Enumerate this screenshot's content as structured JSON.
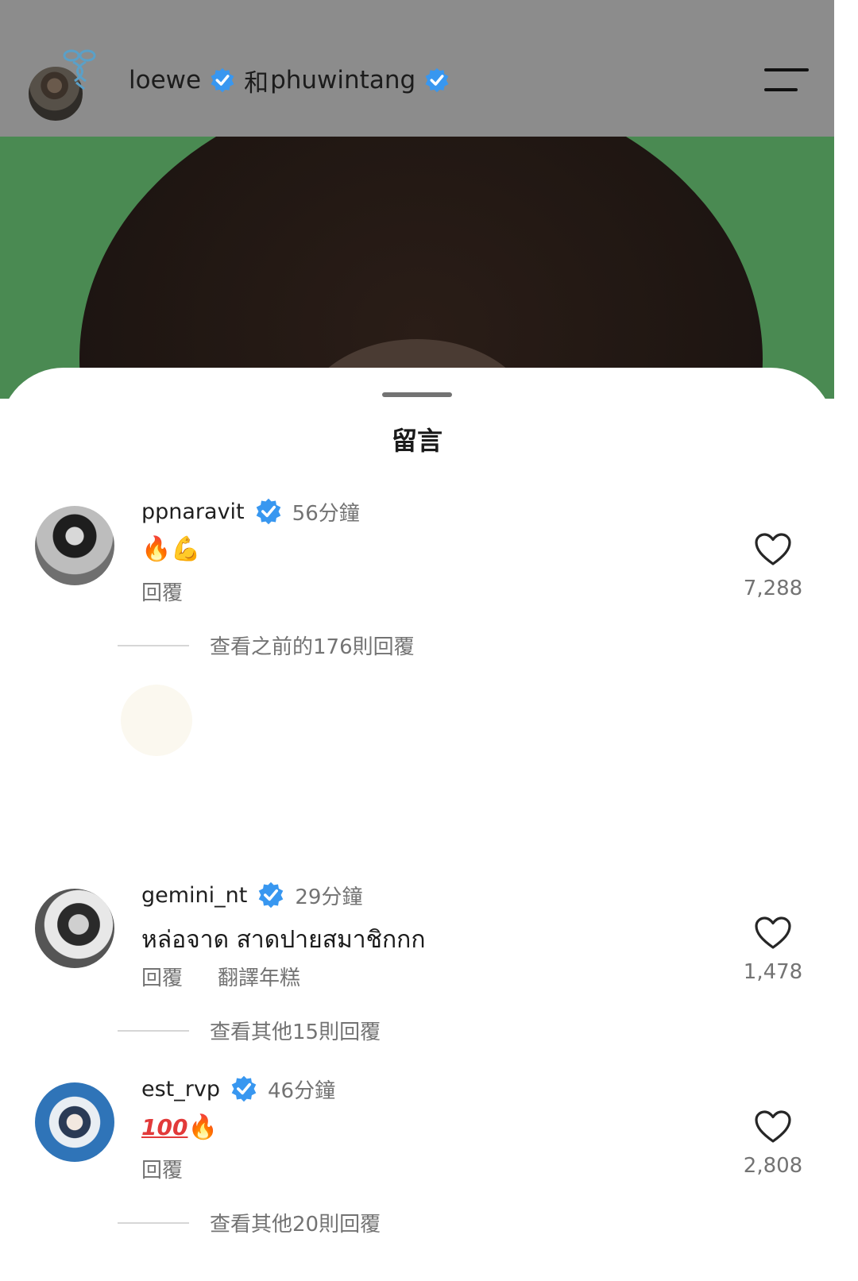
{
  "header": {
    "account1": "loewe",
    "joiner": "和",
    "account2": "phuwintang"
  },
  "sheet": {
    "title": "留言"
  },
  "comments": [
    {
      "username": "ppnaravit",
      "time": "56分鐘",
      "text": "🔥💪",
      "reply_label": "回覆",
      "likes": "7,288",
      "view_more": "查看之前的176則回覆"
    },
    {
      "username": "gemini_nt",
      "time": "29分鐘",
      "text": "หล่อจาด สาดปายสมาชิกกก",
      "reply_label": "回覆",
      "translate_label": "翻譯年糕",
      "likes": "1,478",
      "view_more": "查看其他15則回覆"
    },
    {
      "username": "est_rvp",
      "time": "46分鐘",
      "text_prefix": "100",
      "text_suffix": "🔥",
      "reply_label": "回覆",
      "likes": "2,808",
      "view_more": "查看其他20則回覆"
    }
  ],
  "colors": {
    "verified": "#3897f0",
    "header_bg": "#8c8c8c",
    "photo_green": "#4a8a52",
    "muted_text": "#737373"
  },
  "icons": [
    "verified-badge-icon",
    "menu-icon",
    "heart-icon",
    "loewe-logo"
  ]
}
